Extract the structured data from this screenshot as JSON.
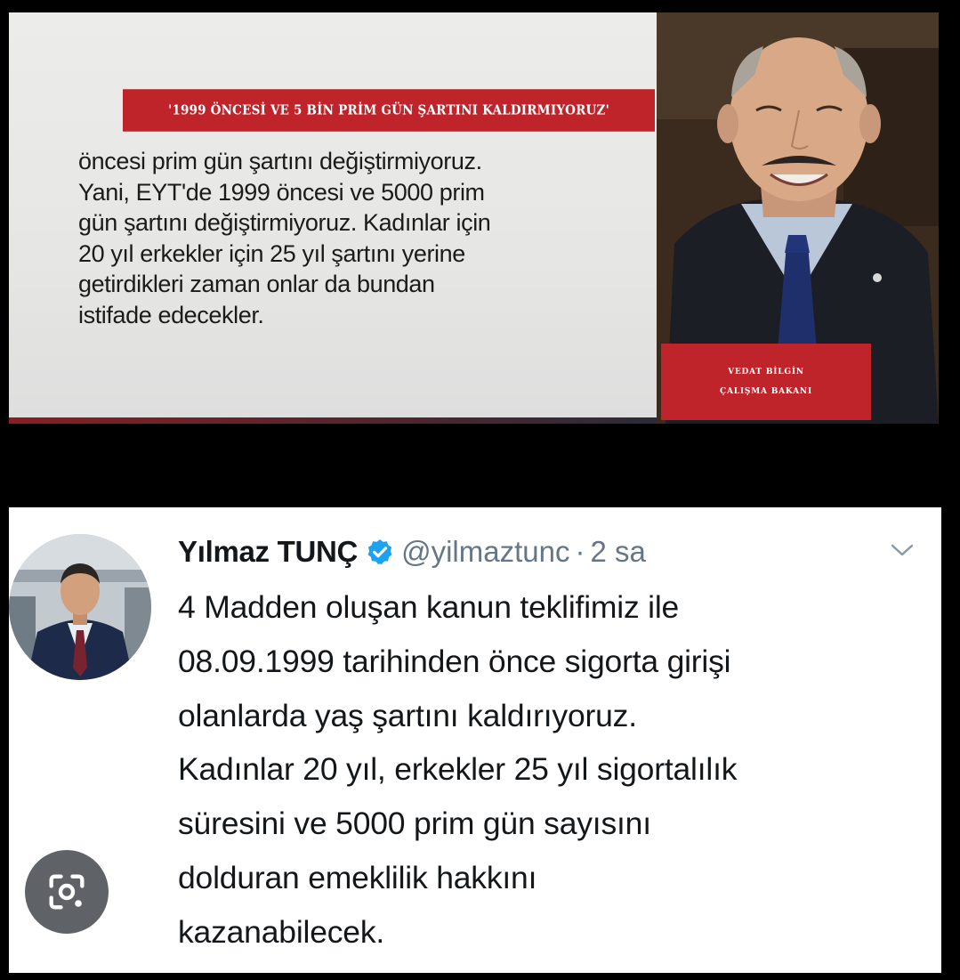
{
  "tv_screen": {
    "headline": "'1999 ÖNCESİ VE 5 BİN PRİM GÜN ŞARTINI KALDIRMIYORUZ'",
    "quote_lines": [
      "öncesi prim gün şartını değiştirmiyoruz.",
      "Yani, EYT'de 1999 öncesi ve 5000 prim",
      "gün şartını değiştirmiyoruz. Kadınlar için",
      "20 yıl erkekler için 25 yıl şartını yerine",
      "getirdikleri zaman onlar da bundan",
      "istifade edecekler."
    ],
    "caption": {
      "name": "VEDAT BİLGİN",
      "title": "ÇALIŞMA BAKANI"
    }
  },
  "tweet": {
    "author": "Yılmaz TUNÇ",
    "handle": "@yilmaztunc",
    "separator": "·",
    "time": "2 sa",
    "text_lines": [
      "4 Madden oluşan kanun teklifimiz ile",
      "08.09.1999 tarihinden önce sigorta girişi",
      "olanlarda yaş şartını kaldırıyoruz.",
      "Kadınlar 20 yıl, erkekler 25 yıl sigortalılık",
      "süresini ve 5000 prim gün sayısını",
      "dolduran emeklilik hakkını",
      "kazanabilecek."
    ]
  },
  "icons": {
    "verified": "verified-badge-icon",
    "menu": "chevron-down-icon",
    "lens": "lens-search-icon"
  },
  "colors": {
    "tv_red": "#c0242b",
    "twitter_blue": "#1da1f2",
    "handle_gray": "#657786",
    "text_dark": "#14171a"
  }
}
